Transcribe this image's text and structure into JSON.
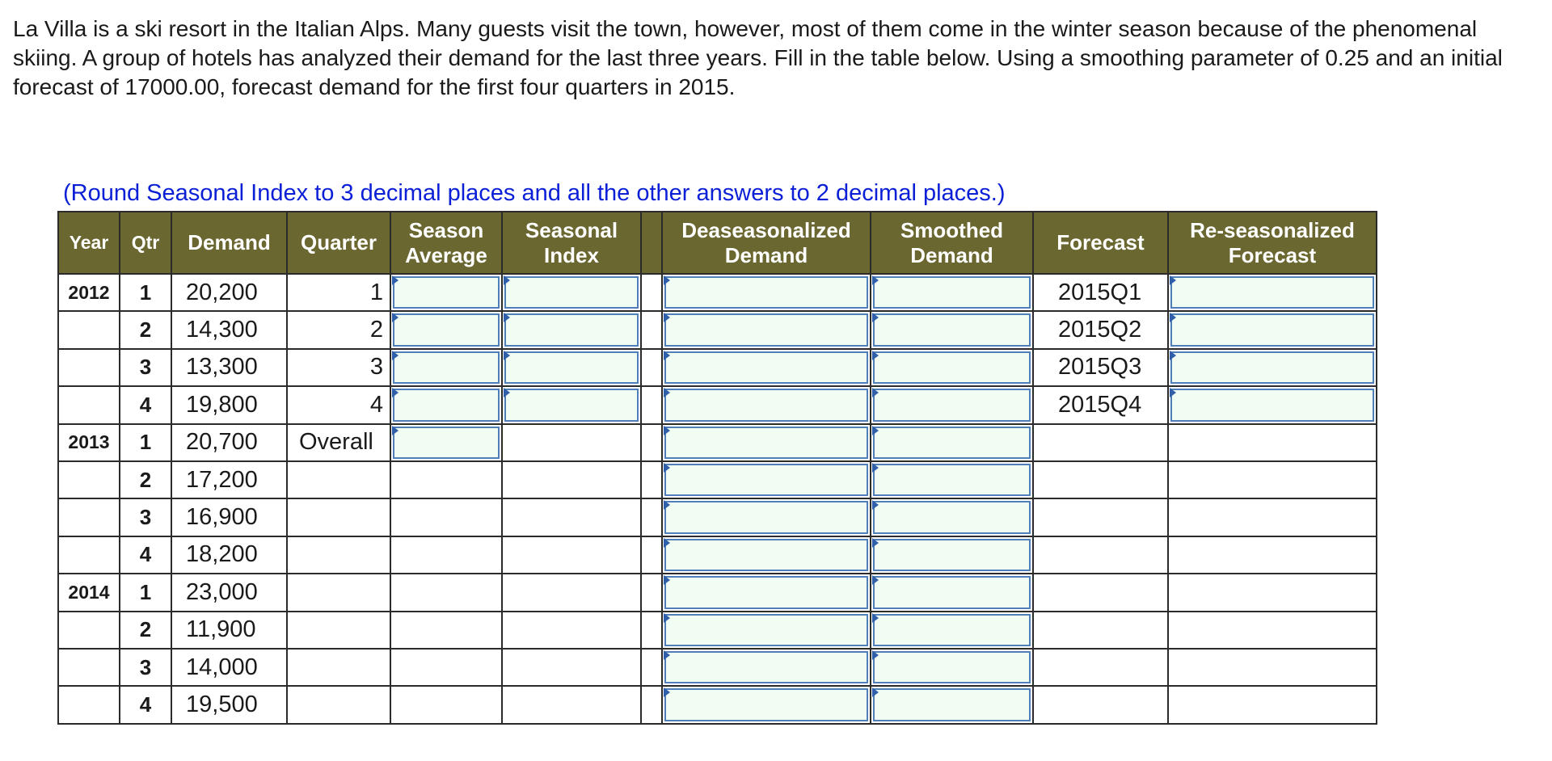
{
  "problem": {
    "text": "La Villa is a ski resort in the Italian Alps. Many guests visit the town, however, most of them come in the winter season because of the phenomenal skiing. A group of hotels has analyzed their demand for the last three years. Fill in the table below. Using a smoothing parameter of 0.25 and an initial forecast of 17000.00, forecast demand for the first four quarters in 2015."
  },
  "note": "(Round Seasonal Index to 3 decimal places and all the other answers to 2 decimal places.)",
  "colors": {
    "header_bg": "#6b6730",
    "input_bg": "#f1fdf3",
    "input_border": "#4f7fb8",
    "note_text": "#0a1fd6"
  },
  "headers": {
    "year": "Year",
    "qtr": "Qtr",
    "demand": "Demand",
    "quarter": "Quarter",
    "season_avg_1": "Season",
    "season_avg_2": "Average",
    "seasonal_idx_1": "Seasonal",
    "seasonal_idx_2": "Index",
    "deseason_1": "Deaseasonalized",
    "deseason_2": "Demand",
    "smoothed_1": "Smoothed",
    "smoothed_2": "Demand",
    "forecast": "Forecast",
    "reseason_1": "Re-seasonalized",
    "reseason_2": "Forecast"
  },
  "rows": [
    {
      "year": "2012",
      "qtr": "1",
      "demand": "20,200",
      "quarter": "1",
      "forecast": "2015Q1"
    },
    {
      "year": "",
      "qtr": "2",
      "demand": "14,300",
      "quarter": "2",
      "forecast": "2015Q2"
    },
    {
      "year": "",
      "qtr": "3",
      "demand": "13,300",
      "quarter": "3",
      "forecast": "2015Q3"
    },
    {
      "year": "",
      "qtr": "4",
      "demand": "19,800",
      "quarter": "4",
      "forecast": "2015Q4"
    },
    {
      "year": "2013",
      "qtr": "1",
      "demand": "20,700",
      "quarter": "Overall",
      "forecast": ""
    },
    {
      "year": "",
      "qtr": "2",
      "demand": "17,200",
      "quarter": "",
      "forecast": ""
    },
    {
      "year": "",
      "qtr": "3",
      "demand": "16,900",
      "quarter": "",
      "forecast": ""
    },
    {
      "year": "",
      "qtr": "4",
      "demand": "18,200",
      "quarter": "",
      "forecast": ""
    },
    {
      "year": "2014",
      "qtr": "1",
      "demand": "23,000",
      "quarter": "",
      "forecast": ""
    },
    {
      "year": "",
      "qtr": "2",
      "demand": "11,900",
      "quarter": "",
      "forecast": ""
    },
    {
      "year": "",
      "qtr": "3",
      "demand": "14,000",
      "quarter": "",
      "forecast": ""
    },
    {
      "year": "",
      "qtr": "4",
      "demand": "19,500",
      "quarter": "",
      "forecast": ""
    }
  ]
}
